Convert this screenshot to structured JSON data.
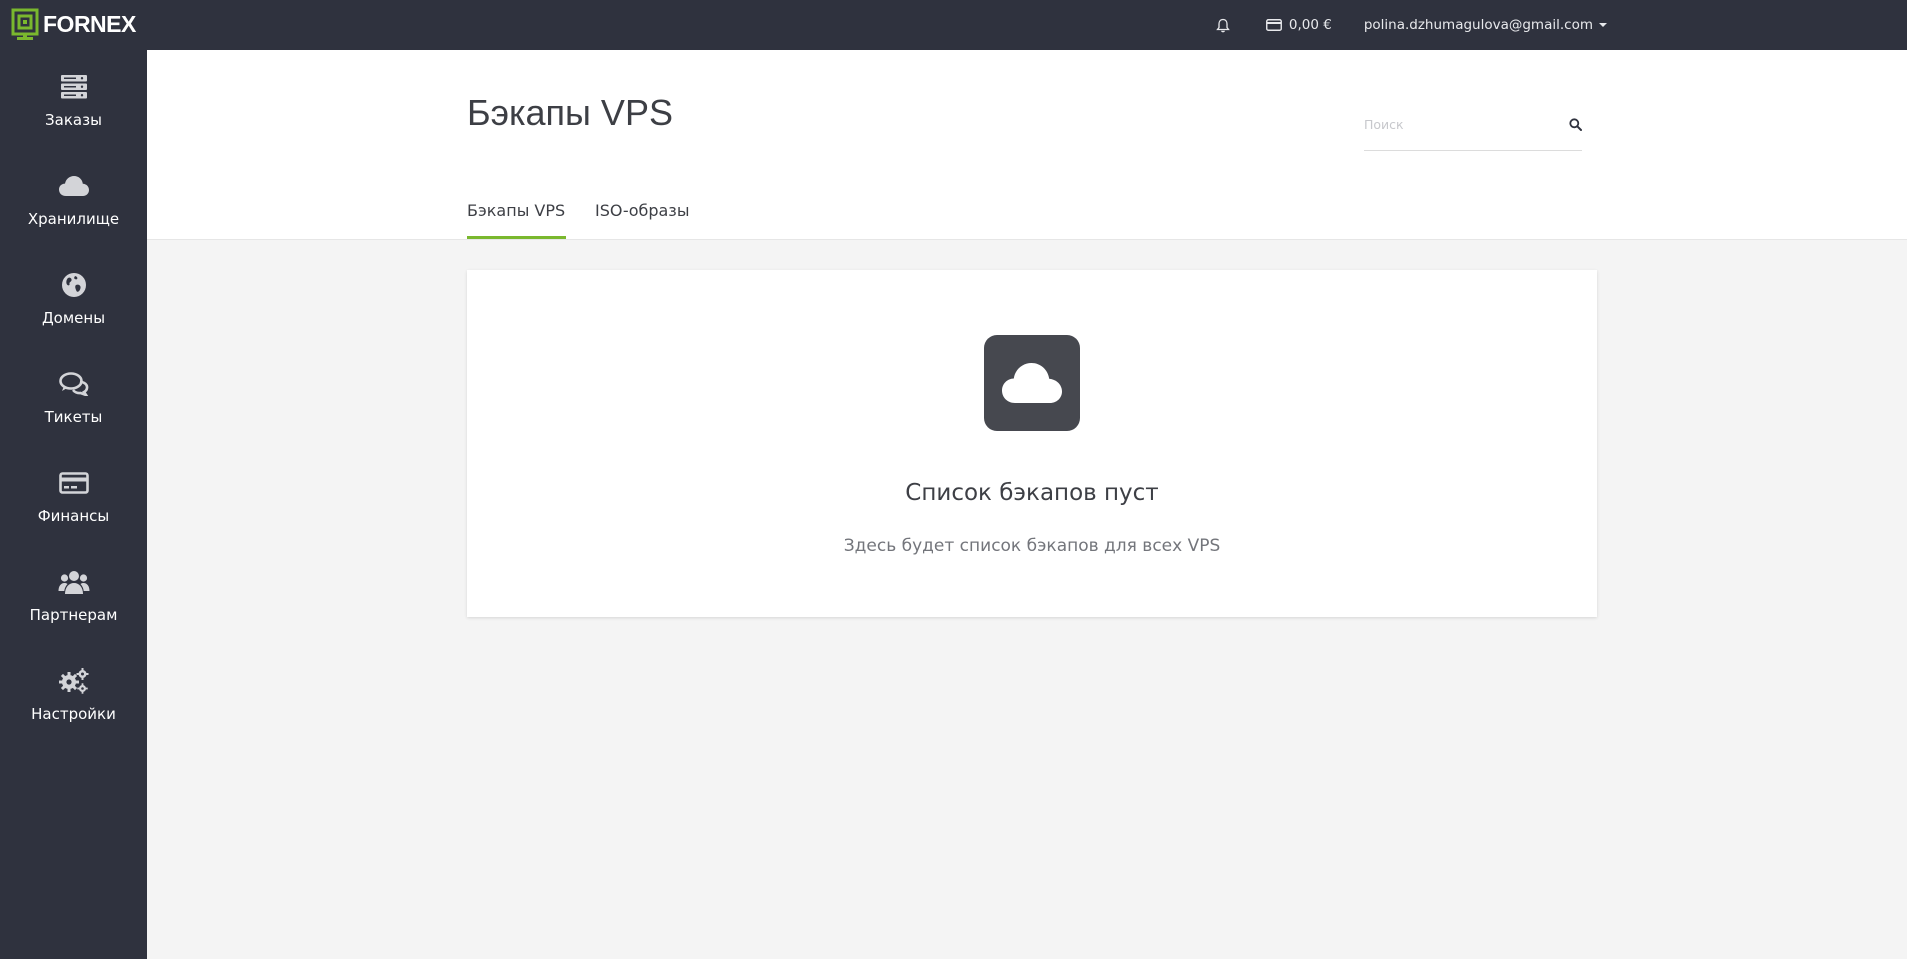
{
  "brand": {
    "name": "FORNEX",
    "accent": "#7ab82e",
    "dark": "#2f323e"
  },
  "topbar": {
    "notifications_icon": "bell-icon",
    "balance": "0,00 €",
    "balance_icon": "credit-card-icon",
    "user_email": "polina.dzhumagulova@gmail.com"
  },
  "sidebar": {
    "items": [
      {
        "label": "Заказы",
        "icon": "server-stack-icon"
      },
      {
        "label": "Хранилище",
        "icon": "cloud-icon"
      },
      {
        "label": "Домены",
        "icon": "globe-icon"
      },
      {
        "label": "Тикеты",
        "icon": "chat-bubbles-icon"
      },
      {
        "label": "Финансы",
        "icon": "credit-card-icon"
      },
      {
        "label": "Партнерам",
        "icon": "users-icon"
      },
      {
        "label": "Настройки",
        "icon": "gears-icon"
      }
    ]
  },
  "header": {
    "title": "Бэкапы VPS",
    "search_placeholder": "Поиск",
    "search_value": ""
  },
  "tabs": [
    {
      "label": "Бэкапы VPS",
      "active": true
    },
    {
      "label": "ISO-образы",
      "active": false
    }
  ],
  "empty_state": {
    "icon": "cloud-icon",
    "title": "Список бэкапов пуст",
    "subtitle": "Здесь будет список бэкапов для всех VPS"
  }
}
